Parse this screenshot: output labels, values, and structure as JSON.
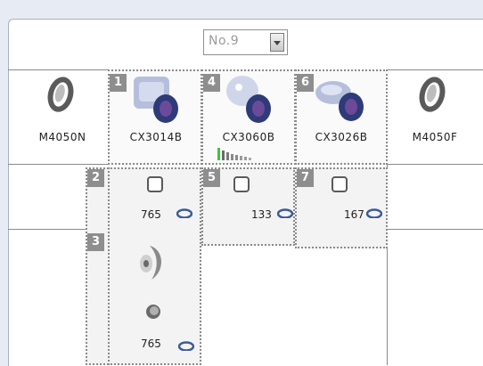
{
  "selector": {
    "value": "No.9"
  },
  "columns": [
    {
      "name": "M4050N"
    },
    {
      "number": "1",
      "name": "CX3014B"
    },
    {
      "number": "4",
      "name": "CX3060B"
    },
    {
      "number": "6",
      "name": "CX3026B"
    },
    {
      "name": "M4050F"
    }
  ],
  "slots": [
    {
      "number": "2",
      "count": "765"
    },
    {
      "number": "5",
      "count": "133"
    },
    {
      "number": "7",
      "count": "167"
    },
    {
      "number": "3",
      "count": "765"
    }
  ],
  "colors": {
    "accent_green": "#33cc33",
    "badge_gray": "#8e8e8e"
  }
}
